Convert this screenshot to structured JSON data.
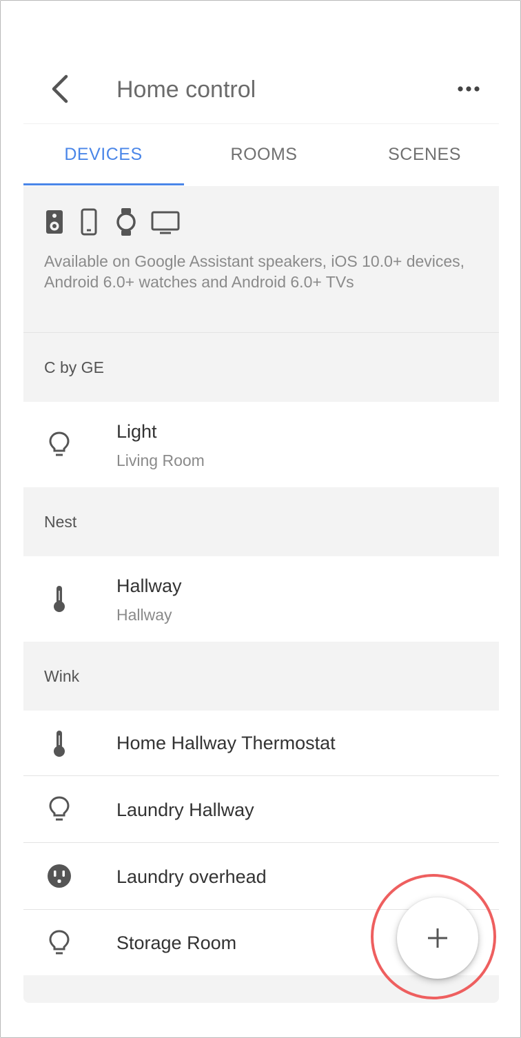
{
  "header": {
    "title": "Home control",
    "back_icon": "chevron-left-icon",
    "more_icon": "more-horizontal-icon"
  },
  "tabs": [
    {
      "label": "DEVICES",
      "active": true
    },
    {
      "label": "ROOMS",
      "active": false
    },
    {
      "label": "SCENES",
      "active": false
    }
  ],
  "colors": {
    "accent": "#4a86e8",
    "highlight_ring": "#ee5f5f"
  },
  "info": {
    "icons": [
      "speaker-icon",
      "phone-icon",
      "watch-icon",
      "tv-icon"
    ],
    "text": "Available on Google Assistant speakers, iOS 10.0+ devices, Android 6.0+ watches and Android 6.0+ TVs"
  },
  "sections": [
    {
      "name": "C by GE",
      "devices": [
        {
          "title": "Light",
          "subtitle": "Living Room",
          "icon": "lightbulb-icon"
        }
      ]
    },
    {
      "name": "Nest",
      "devices": [
        {
          "title": "Hallway",
          "subtitle": "Hallway",
          "icon": "thermometer-icon"
        }
      ]
    },
    {
      "name": "Wink",
      "devices": [
        {
          "title": "Home Hallway Thermostat",
          "icon": "thermometer-icon"
        },
        {
          "title": "Laundry Hallway",
          "icon": "lightbulb-icon"
        },
        {
          "title": "Laundry overhead",
          "icon": "outlet-icon"
        },
        {
          "title": "Storage Room",
          "icon": "lightbulb-icon"
        }
      ]
    }
  ],
  "fab": {
    "icon": "plus-icon"
  }
}
